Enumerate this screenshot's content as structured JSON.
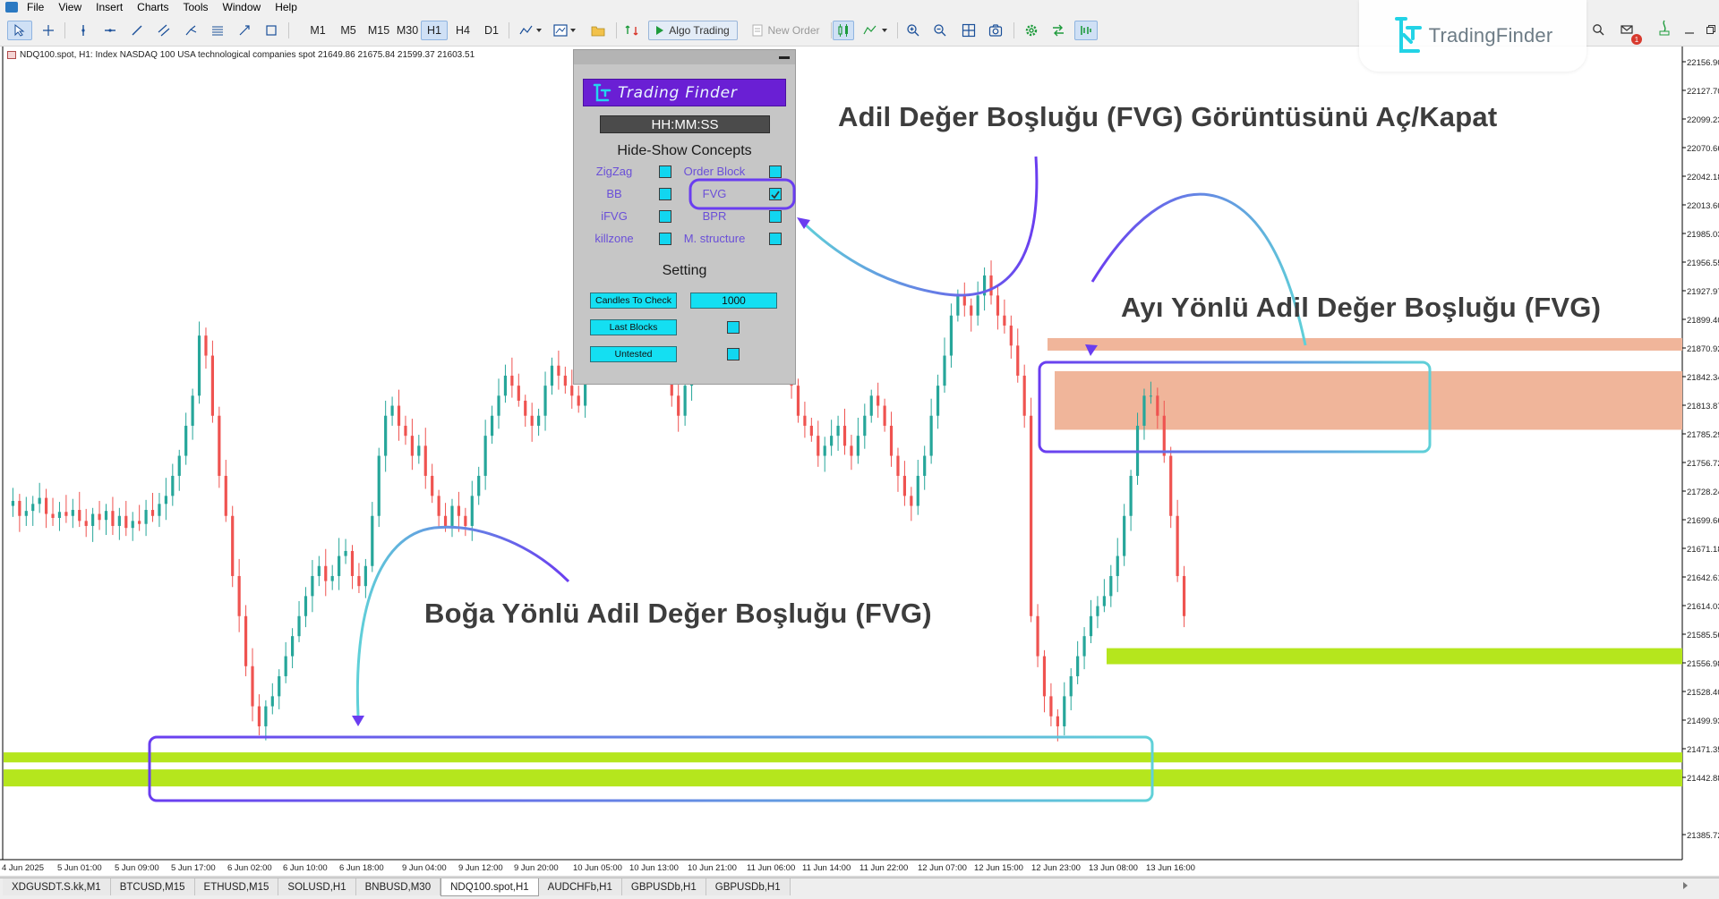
{
  "menu": [
    "File",
    "View",
    "Insert",
    "Charts",
    "Tools",
    "Window",
    "Help"
  ],
  "toolbar": {
    "timeframes": [
      "M1",
      "M5",
      "M15",
      "M30",
      "H1",
      "H4",
      "D1"
    ],
    "selected_timeframe": "H1",
    "algo_trading": "Algo Trading",
    "new_order": "New Order"
  },
  "notifications_count": "1",
  "logo_text": "TradingFinder",
  "symbol_info": "NDQ100.spot, H1:  Index NASDAQ 100 USA technological companies spot  21649.86 21675.84 21599.37 21603.51",
  "panel": {
    "banner": "Trading Finder",
    "clock": "HH:MM:SS",
    "concepts_title": "Hide-Show Concepts",
    "concepts": [
      {
        "left": "ZigZag",
        "right": "Order Block"
      },
      {
        "left": "BB",
        "right": "FVG"
      },
      {
        "left": "iFVG",
        "right": "BPR"
      },
      {
        "left": "killzone",
        "right": "M. structure"
      }
    ],
    "checked": "FVG",
    "setting_title": "Setting",
    "candles_to_check_label": "Candles To Check",
    "candles_to_check_value": "1000",
    "last_blocks_label": "Last Blocks",
    "untested_label": "Untested"
  },
  "annotations": {
    "toggle": "Adil Değer Boşluğu (FVG) Görüntüsünü Aç/Kapat",
    "bearish": "Ayı Yönlü Adil Değer Boşluğu (FVG)",
    "bullish": "Boğa Yönlü Adil Değer Boşluğu (FVG)"
  },
  "price_scale": [
    "22156.90",
    "22127.70",
    "22099.23",
    "22070.66",
    "22042.18",
    "22013.60",
    "21985.03",
    "21956.55",
    "21927.97",
    "21899.40",
    "21870.92",
    "21842.34",
    "21813.87",
    "21785.29",
    "21756.72",
    "21728.24",
    "21699.66",
    "21671.18",
    "21642.61",
    "21614.03",
    "21585.56",
    "21556.98",
    "21528.40",
    "21499.93",
    "21471.35",
    "21442.88",
    "21385.72"
  ],
  "time_scale": [
    "4 Jun 2025",
    "5 Jun 01:00",
    "5 Jun 09:00",
    "5 Jun 17:00",
    "6 Jun 02:00",
    "6 Jun 10:00",
    "6 Jun 18:00",
    "9 Jun 04:00",
    "9 Jun 12:00",
    "9 Jun 20:00",
    "10 Jun 05:00",
    "10 Jun 13:00",
    "10 Jun 21:00",
    "11 Jun 06:00",
    "11 Jun 14:00",
    "11 Jun 22:00",
    "12 Jun 07:00",
    "12 Jun 15:00",
    "12 Jun 23:00",
    "13 Jun 08:00",
    "13 Jun 16:00"
  ],
  "tabs": [
    "XDGUSDT.S.kk,M1",
    "BTCUSD,M15",
    "ETHUSD,M15",
    "SOLUSD,H1",
    "BNBUSD,M30",
    "NDQ100.spot,H1",
    "AUDCHFb,H1",
    "GBPUSDb,H1",
    "GBPUSDb,H1"
  ],
  "active_tab": "NDQ100.spot,H1",
  "colors": {
    "bull_candle": "#26a69a",
    "bear_candle": "#ef5350",
    "bull_fvg": "#b5e61d",
    "bear_fvg": "#f0b59a",
    "highlight_purple": "#6a3df0",
    "highlight_cyan": "#5fd0d8"
  }
}
